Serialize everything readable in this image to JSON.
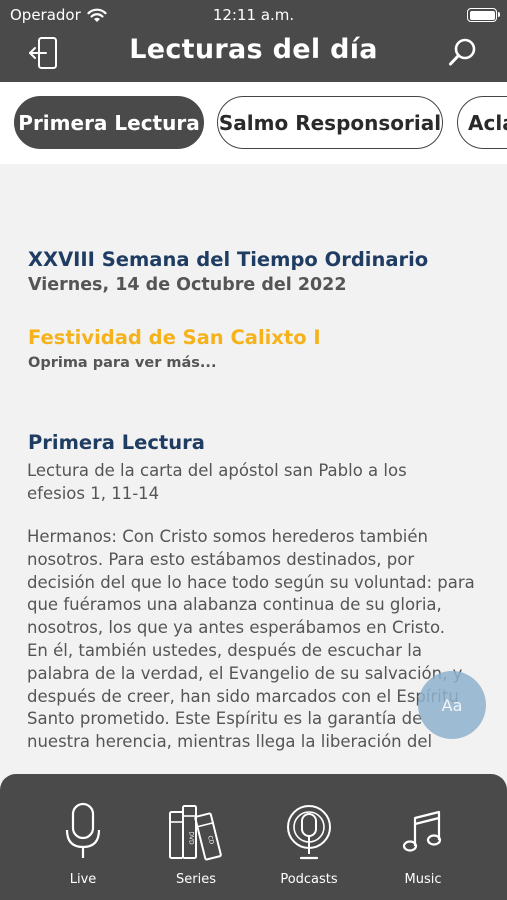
{
  "status_bar": {
    "carrier": "Operador",
    "time": "12:11 a.m."
  },
  "header": {
    "title": "Lecturas del día",
    "left_icon": "exit-icon",
    "right_icon": "search-icon"
  },
  "tabs": [
    {
      "label": "Primera Lectura",
      "active": true
    },
    {
      "label": "Salmo Responsorial",
      "active": false
    },
    {
      "label": "Acla",
      "active": false
    }
  ],
  "liturgy": {
    "week": "XXVIII Semana del Tiempo Ordinario",
    "date": "Viernes, 14 de Octubre del 2022",
    "feast": "Festividad de San Calixto I",
    "more_hint": "Oprima para ver más..."
  },
  "reading": {
    "title": "Primera Lectura",
    "subtitle": "Lectura de la carta del apóstol san Pablo a los efesios 1, 11-14",
    "paragraph_1": "Hermanos: Con Cristo somos herederos también nosotros. Para esto estábamos destinados, por decisión del que lo hace todo según su voluntad: para que fuéramos una alabanza continua de su gloria, nosotros, los que ya antes esperábamos en Cristo.",
    "paragraph_2": "En él, también ustedes, después de escuchar la palabra de la verdad, el Evangelio de su salvación, y después de creer, han sido marcados con el Espíritu Santo prometido. Este Espíritu es la garantía de nuestra herencia, mientras llega la liberación del"
  },
  "font_button": {
    "label": "Aa"
  },
  "bottom_nav": [
    {
      "label": "Live",
      "icon": "microphone-icon"
    },
    {
      "label": "Series",
      "icon": "books-icon"
    },
    {
      "label": "Podcasts",
      "icon": "podcast-icon"
    },
    {
      "label": "Music",
      "icon": "music-note-icon"
    }
  ],
  "colors": {
    "header_bg": "#4a4a4a",
    "heading_blue": "#1f3c63",
    "feast_gold": "#f5b21a",
    "text_gray": "#555555"
  }
}
